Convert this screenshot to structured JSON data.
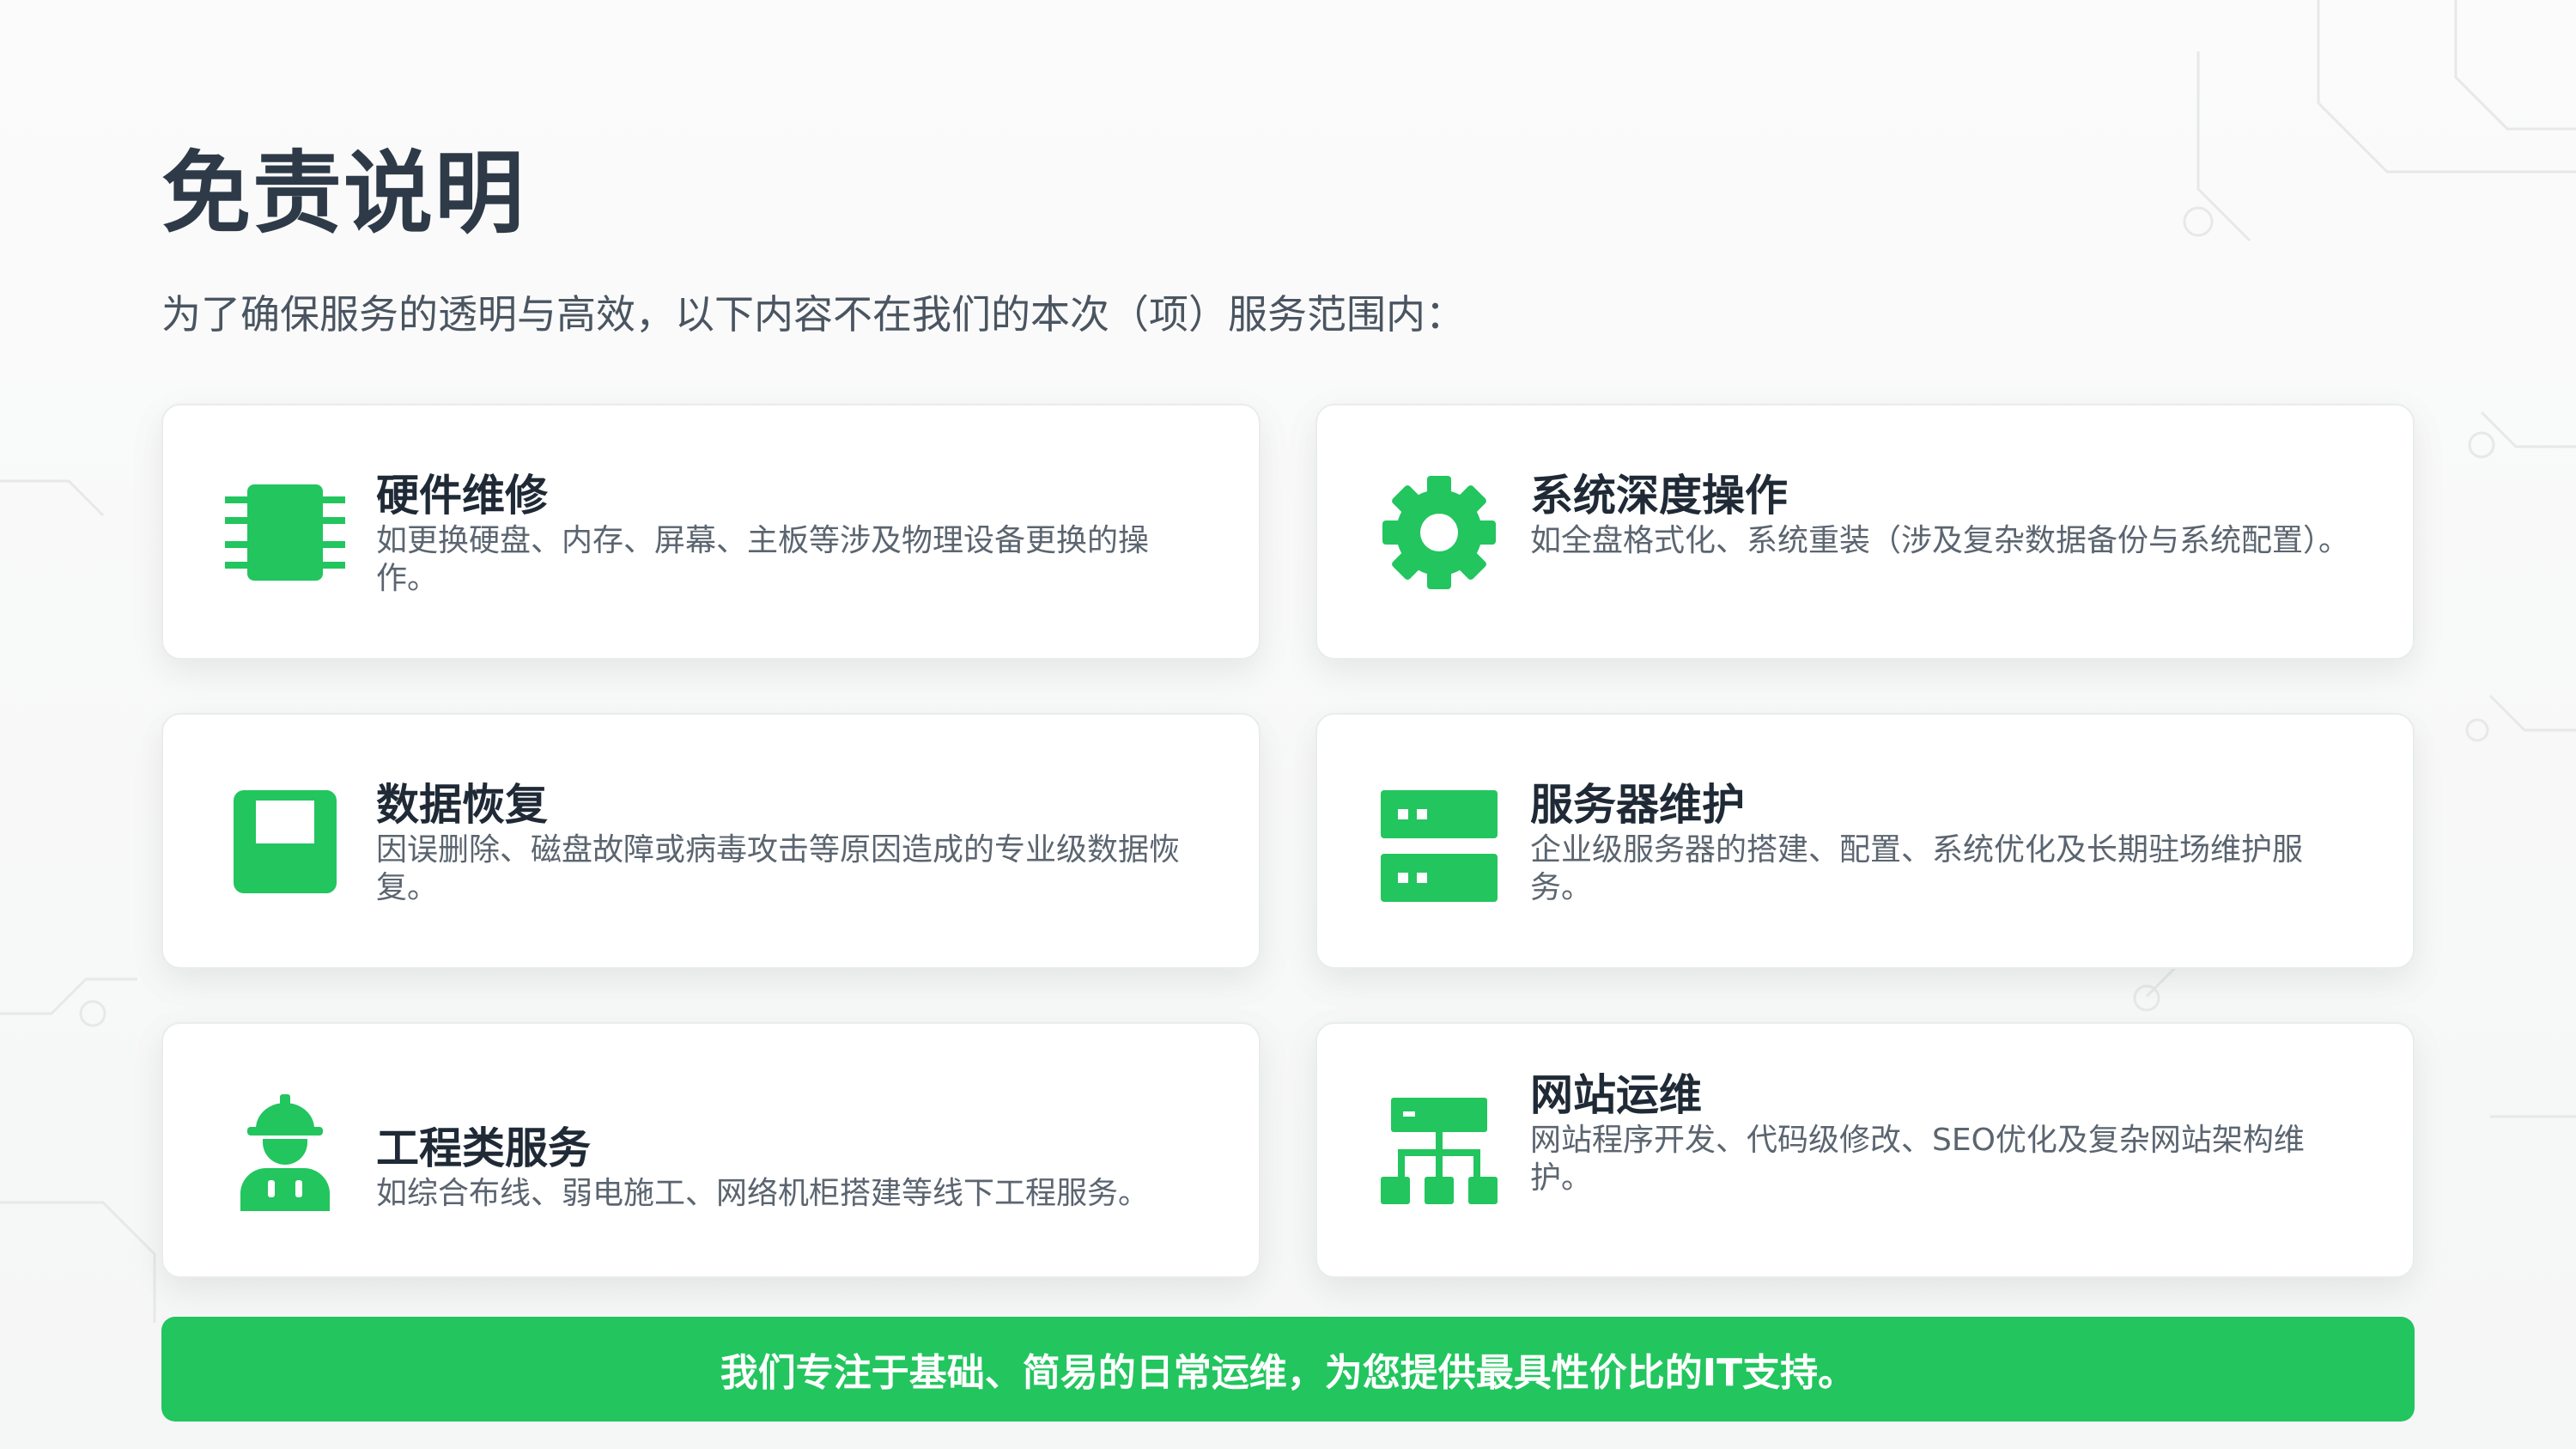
{
  "title": "免责说明",
  "subtitle": "为了确保服务的透明与高效，以下内容不在我们的本次（项）服务范围内：",
  "accent_color": "#22c55e",
  "cards": [
    {
      "icon": "chip-icon",
      "title": "硬件维修",
      "desc": "如更换硬盘、内存、屏幕、主板等涉及物理设备更换的操作。"
    },
    {
      "icon": "gear-icon",
      "title": "系统深度操作",
      "desc": "如全盘格式化、系统重装（涉及复杂数据备份与系统配置）。"
    },
    {
      "icon": "floppy-disk-icon",
      "title": "数据恢复",
      "desc": "因误删除、磁盘故障或病毒攻击等原因造成的专业级数据恢复。"
    },
    {
      "icon": "server-icon",
      "title": "服务器维护",
      "desc": "企业级服务器的搭建、配置、系统优化及长期驻场维护服务。"
    },
    {
      "icon": "engineer-icon",
      "title": "工程类服务",
      "desc": "如综合布线、弱电施工、网络机柜搭建等线下工程服务。"
    },
    {
      "icon": "sitemap-icon",
      "title": "网站运维",
      "desc": "网站程序开发、代码级修改、SEO优化及复杂网站架构维护。"
    }
  ],
  "banner": "我们专注于基础、简易的日常运维，为您提供最具性价比的IT支持。"
}
